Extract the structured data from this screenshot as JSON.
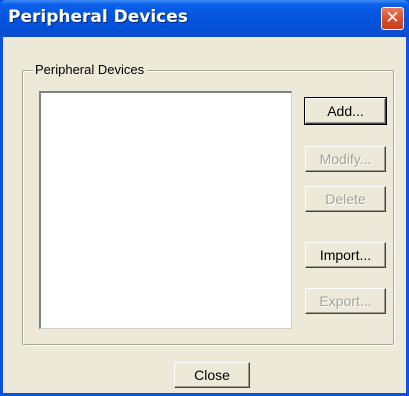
{
  "window": {
    "title": "Peripheral Devices",
    "close_glyph": "✕"
  },
  "group": {
    "label": "Peripheral Devices",
    "items": []
  },
  "buttons": {
    "add": "Add...",
    "modify": "Modify...",
    "delete": "Delete",
    "import": "Import...",
    "export": "Export...",
    "close": "Close"
  },
  "state": {
    "add_enabled": true,
    "modify_enabled": false,
    "delete_enabled": false,
    "import_enabled": true,
    "export_enabled": false
  },
  "colors": {
    "titlebar": "#0554e0",
    "dialog_face": "#ece9d8",
    "disabled_text": "#a5a394",
    "close_button": "#d8512d"
  }
}
